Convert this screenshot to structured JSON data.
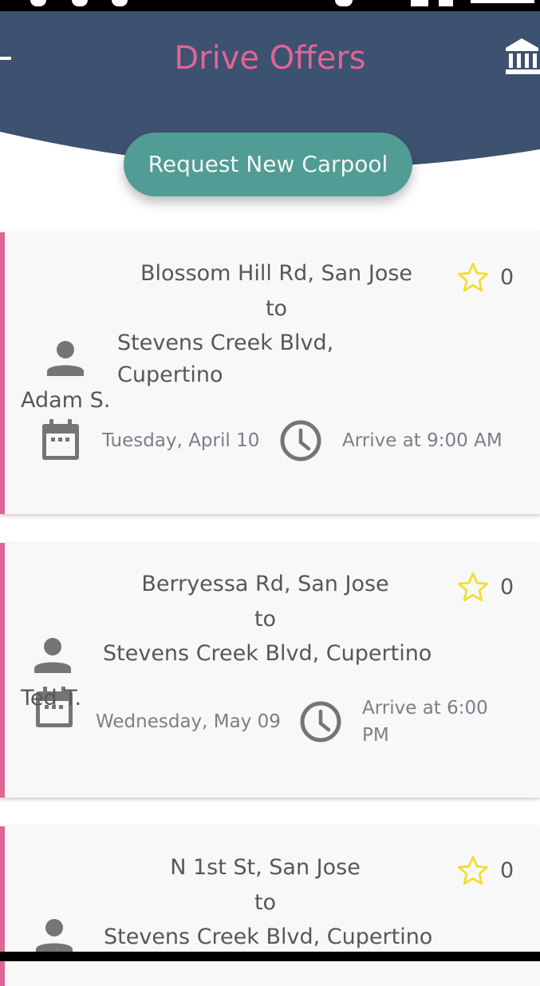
{
  "header": {
    "title": "Drive Offers"
  },
  "request_button": {
    "label": "Request New Carpool"
  },
  "colors": {
    "header": "#3d5170",
    "accent": "#e06594",
    "button": "#519c94",
    "star": "#f1df2f"
  },
  "offers": [
    {
      "from": "Blossom Hill Rd, San Jose",
      "connector": "to",
      "to_line1": "Stevens Creek Blvd,",
      "to_line2": "Cupertino",
      "driver": "Adam S.",
      "rating": "0",
      "date": "Tuesday, April 10",
      "arrival": "Arrive at 9:00 AM"
    },
    {
      "from": "Berryessa Rd, San Jose",
      "connector": "to",
      "to": "Stevens Creek Blvd, Cupertino",
      "driver": "Ted T.",
      "rating": "0",
      "date": "Wednesday, May 09",
      "arrival_line1": "Arrive at 6:00",
      "arrival_line2": "PM"
    },
    {
      "from": "N 1st St, San Jose",
      "connector": "to",
      "to": "Stevens Creek Blvd, Cupertino",
      "rating": "0"
    }
  ]
}
